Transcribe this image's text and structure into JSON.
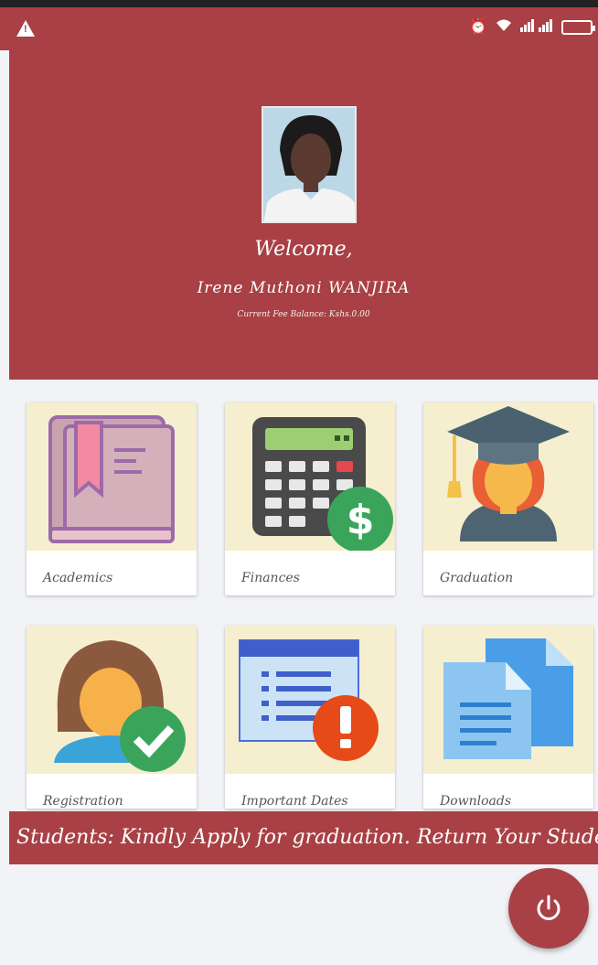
{
  "header": {
    "welcome": "Welcome,",
    "student_name": "Irene Muthoni WANJIRA",
    "balance": "Current Fee Balance: Kshs.0.00"
  },
  "tiles": [
    {
      "label": "Academics",
      "icon": "book-icon"
    },
    {
      "label": "Finances",
      "icon": "calculator-icon"
    },
    {
      "label": "Graduation",
      "icon": "graduate-icon"
    },
    {
      "label": "Registration",
      "icon": "student-check-icon"
    },
    {
      "label": "Important Dates",
      "icon": "calendar-alert-icon"
    },
    {
      "label": "Downloads",
      "icon": "documents-icon"
    }
  ],
  "marquee": "Students: Kindly Apply for graduation. Return Your Student",
  "colors": {
    "primary": "#a94045",
    "tile_art_bg": "#f5efcf",
    "page_bg": "#f2f3f7"
  }
}
